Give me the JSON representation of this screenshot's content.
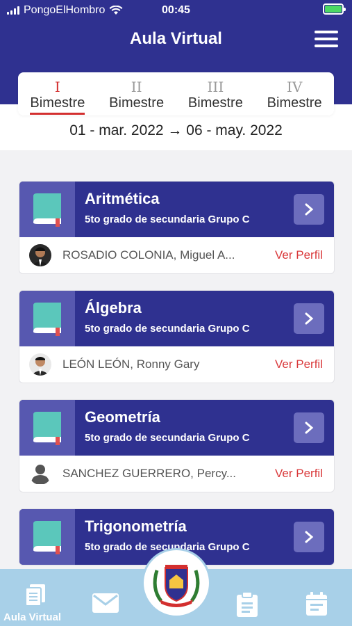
{
  "status_bar": {
    "carrier": "PongoElHombro",
    "time": "00:45"
  },
  "header": {
    "title": "Aula Virtual"
  },
  "tabs": [
    {
      "numeral": "I",
      "label": "Bimestre",
      "active": true
    },
    {
      "numeral": "II",
      "label": "Bimestre",
      "active": false
    },
    {
      "numeral": "III",
      "label": "Bimestre",
      "active": false
    },
    {
      "numeral": "IV",
      "label": "Bimestre",
      "active": false
    }
  ],
  "date_range": "01 - mar. 2022 → 06 - may. 2022",
  "courses": [
    {
      "subject": "Aritmética",
      "grade": "5to grado de secundaria Grupo C",
      "teacher": "ROSADIO COLONIA, Miguel A...",
      "profile_link": "Ver Perfil"
    },
    {
      "subject": "Álgebra",
      "grade": "5to grado de secundaria Grupo C",
      "teacher": "LEÓN LEÓN, Ronny Gary",
      "profile_link": "Ver Perfil"
    },
    {
      "subject": "Geometría",
      "grade": "5to grado de secundaria Grupo C",
      "teacher": "SANCHEZ GUERRERO, Percy...",
      "profile_link": "Ver Perfil"
    },
    {
      "subject": "Trigonometría",
      "grade": "5to grado de secundaria Grupo C",
      "teacher": "",
      "profile_link": ""
    }
  ],
  "bottom_nav": {
    "active_label": "Aula Virtual"
  },
  "colors": {
    "primary": "#2f3190",
    "accent": "#d32f2f",
    "book": "#5bc7bb",
    "bottom_bar": "#a8d0e8"
  }
}
